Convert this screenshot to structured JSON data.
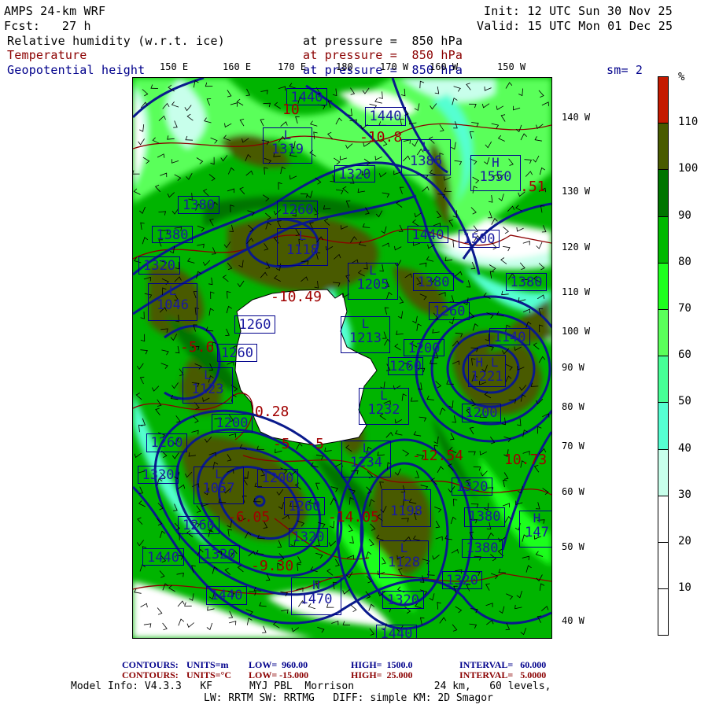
{
  "header": {
    "model": "AMPS 24-km WRF",
    "init": "Init: 12 UTC Sun 30 Nov 25",
    "fcst": "Fcst:   27 h",
    "valid": "Valid: 15 UTC Mon 01 Dec 25",
    "fields": [
      {
        "name": "Relative humidity (w.r.t. ice)",
        "level": "at pressure =  850 hPa",
        "color": "#000000"
      },
      {
        "name": "Temperature",
        "level": "at pressure =  850 hPa",
        "color": "#8b0000"
      },
      {
        "name": "Geopotential height",
        "level": "at pressure =  850 hPa",
        "color": "#00008b"
      }
    ],
    "smoothing": "sm= 2"
  },
  "axes": {
    "top": [
      "150 E",
      "160 E",
      "170 E",
      "180",
      "170 W",
      "160 W",
      "150 W"
    ],
    "right": [
      "140 W",
      "130 W",
      "120 W",
      "110 W",
      "100 W",
      "90 W",
      "80 W",
      "70 W",
      "60 W",
      "50 W",
      "40 W"
    ]
  },
  "colorbar": {
    "unit": "%",
    "labels": [
      "110",
      "100",
      "90",
      "80",
      "70",
      "60",
      "50",
      "40",
      "30",
      "20",
      "10"
    ],
    "colors": [
      "#c41a00",
      "#485a00",
      "#007400",
      "#00b800",
      "#1eff1e",
      "#5aff5a",
      "#46ff96",
      "#55ffd2",
      "#c8ffeb",
      "#ffffff",
      "#ffffff",
      "#ffffff"
    ]
  },
  "contours": {
    "height_labels": [
      "1440",
      "1440",
      "1319",
      "1320",
      "1386",
      "1550",
      "1380",
      "1260",
      "1380",
      "1440",
      "1500",
      "1118",
      "1320",
      "1205",
      "1380",
      "1380",
      "1046",
      "1260",
      "1260",
      "1213",
      "1140",
      "1260",
      "1200",
      "1123",
      "1200",
      "1260",
      "1232",
      "1221",
      "1200",
      "1260",
      "1234",
      "1320",
      "1057",
      "1200",
      "1260",
      "1320",
      "1198",
      "1260",
      "1320",
      "1380",
      "147",
      "1380",
      "1440",
      "1320",
      "1128",
      "1320",
      "1440",
      "1470",
      "1320",
      "1440"
    ],
    "temperature_labels": [
      "10",
      "-10.8",
      ".51",
      "-10.49",
      "-5.6",
      "0.28",
      "-5  -5",
      "-6.05",
      "-14.05",
      "-12.54",
      "-9.30",
      "10.73"
    ]
  },
  "footer": {
    "height_contours": {
      "label": "CONTOURS:",
      "units": "UNITS=m",
      "low": "LOW=  960.00",
      "high": "HIGH=  1500.0",
      "interval": "INTERVAL=   60.000"
    },
    "temp_contours": {
      "label": "CONTOURS:",
      "units": "UNITS=°C",
      "low": "LOW= -15.000",
      "high": "HIGH=  25.000",
      "interval": "INTERVAL=   5.0000"
    },
    "model_info_1": "Model Info: V4.3.3   KF      MYJ PBL  Morrison             24 km,   60 levels,",
    "model_info_2": "LW: RRTM SW: RRTMG   DIFF: simple KM: 2D Smagor"
  }
}
